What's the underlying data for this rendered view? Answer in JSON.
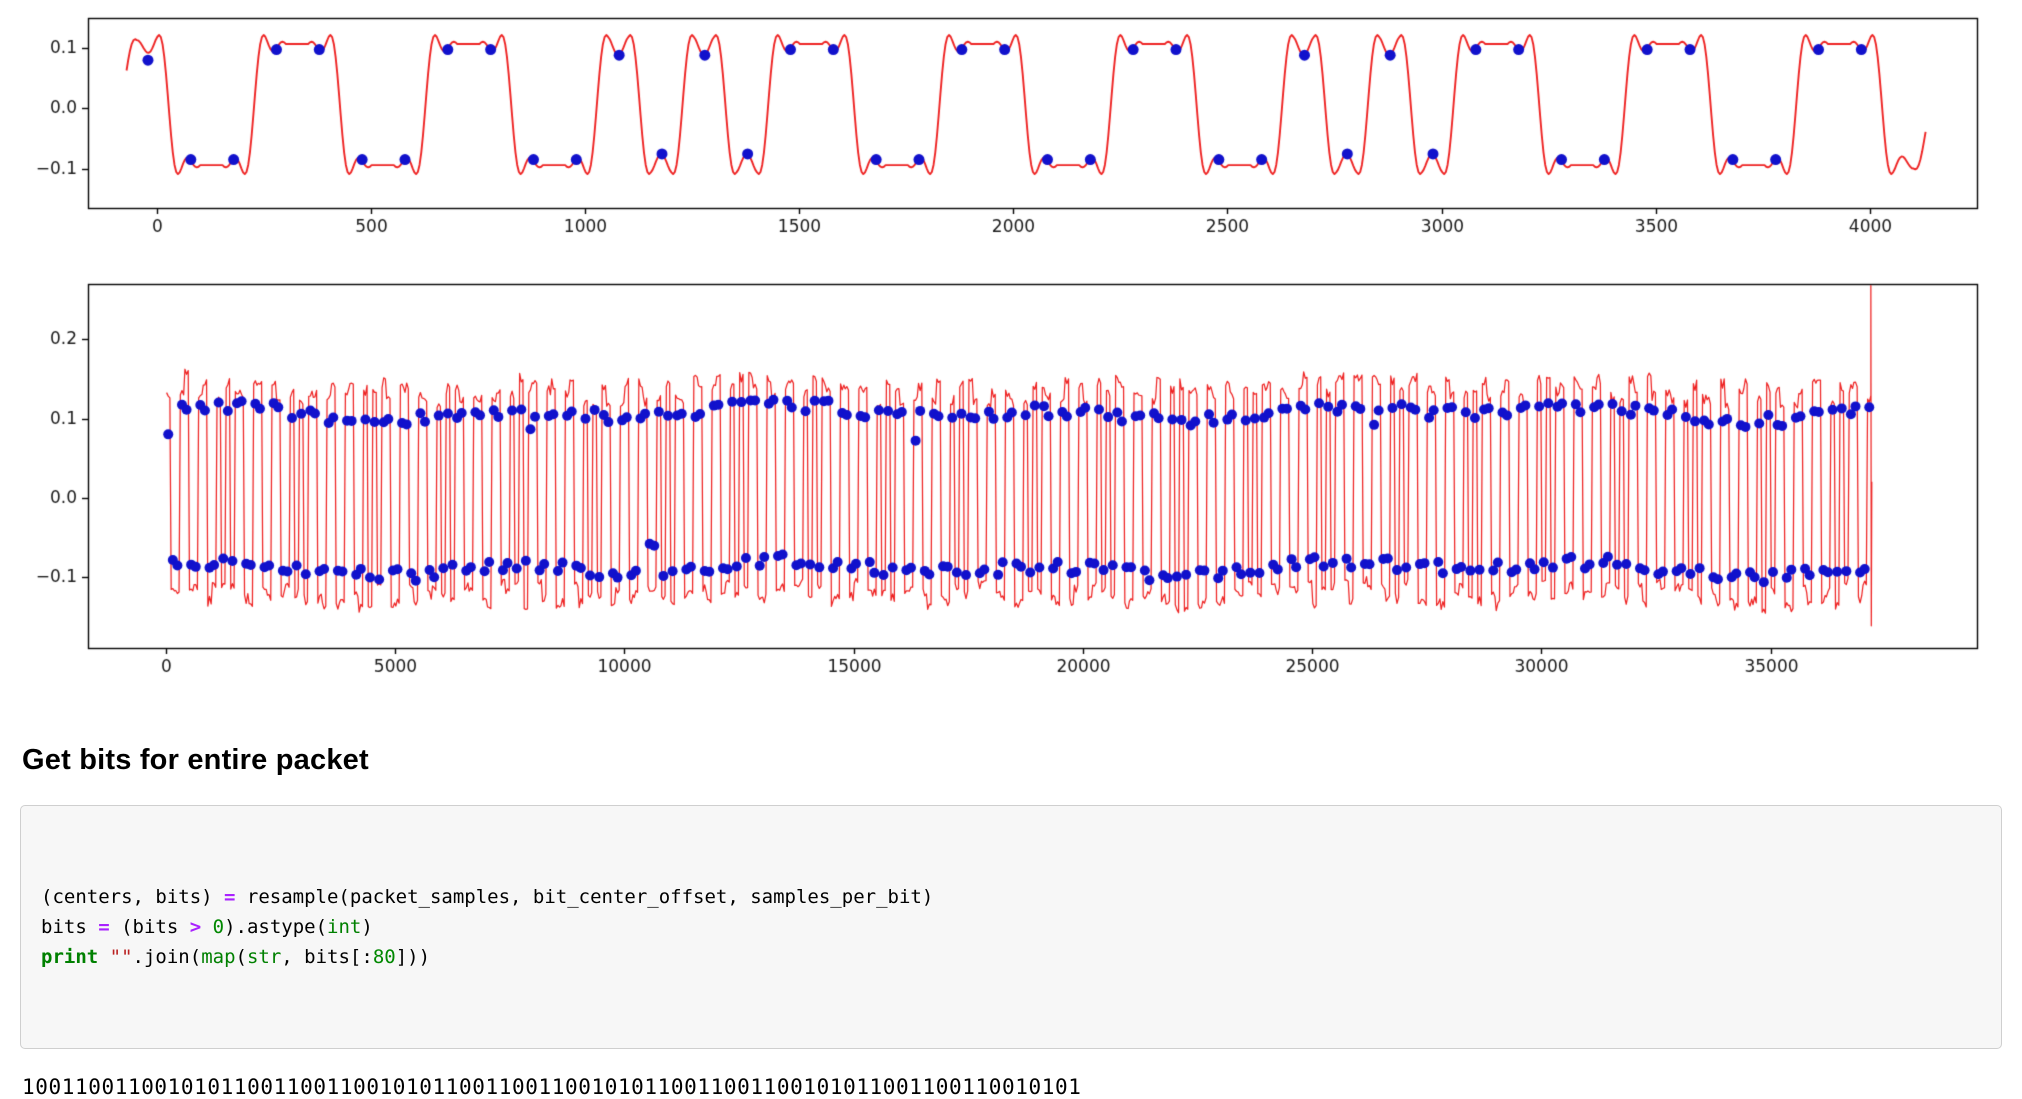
{
  "heading": {
    "text": "Get bits for entire packet"
  },
  "code": {
    "bold_classes": [
      "op",
      "kw"
    ],
    "colors": {
      "pln": "#000000",
      "op": "#AA22FF",
      "kw": "#008000",
      "bi": "#008000",
      "num": "#008800",
      "str": "#BA2121"
    },
    "lines": [
      [
        {
          "t": "(centers, bits) ",
          "c": "pln"
        },
        {
          "t": "=",
          "c": "op"
        },
        {
          "t": " resample(packet_samples, bit_center_offset, samples_per_bit)",
          "c": "pln"
        }
      ],
      [
        {
          "t": "bits ",
          "c": "pln"
        },
        {
          "t": "=",
          "c": "op"
        },
        {
          "t": " (bits ",
          "c": "pln"
        },
        {
          "t": ">",
          "c": "op"
        },
        {
          "t": " ",
          "c": "pln"
        },
        {
          "t": "0",
          "c": "num"
        },
        {
          "t": ").astype(",
          "c": "pln"
        },
        {
          "t": "int",
          "c": "bi"
        },
        {
          "t": ")",
          "c": "pln"
        }
      ],
      [
        {
          "t": "print",
          "c": "kw"
        },
        {
          "t": " ",
          "c": "pln"
        },
        {
          "t": "\"\"",
          "c": "str"
        },
        {
          "t": ".join(",
          "c": "pln"
        },
        {
          "t": "map",
          "c": "bi"
        },
        {
          "t": "(",
          "c": "pln"
        },
        {
          "t": "str",
          "c": "bi"
        },
        {
          "t": ", bits[:",
          "c": "pln"
        },
        {
          "t": "80",
          "c": "num"
        },
        {
          "t": "]))",
          "c": "pln"
        }
      ]
    ]
  },
  "output": {
    "bits": "10011001100101011001100110010101100110011001010110011001100101011001100110010101"
  },
  "chart_data": [
    {
      "type": "line",
      "title": "",
      "description": "Start of packet: filtered bit waveform (red line) with resampled bit-center samples (blue dots)",
      "xlim": [
        -160,
        4250
      ],
      "ylim": [
        -0.165,
        0.15
      ],
      "xticks": [
        0,
        500,
        1000,
        1500,
        2000,
        2500,
        3000,
        3500,
        4000
      ],
      "yticks": [
        -0.1,
        0.0,
        0.1
      ],
      "grid": false,
      "legend": null,
      "series": [
        {
          "name": "packet_samples",
          "kind": "line",
          "color": "#ee2222"
        },
        {
          "name": "bit_centers",
          "kind": "scatter",
          "color": "#1111cc"
        }
      ],
      "signal": {
        "bits_from": "output.bits",
        "num_bits": 42,
        "num_dots": 41,
        "samples_per_bit": 100,
        "x_start": -70,
        "high_level": 0.107,
        "low_level": -0.094,
        "ripple_wavelength": 44,
        "first_dot_y": 0.08
      }
    },
    {
      "type": "line",
      "title": "",
      "description": "Entire packet: bit waveform (red) with resampled bit-center samples (blue dots) and end-of-packet spike",
      "xlim": [
        -1700,
        39500
      ],
      "ylim": [
        -0.19,
        0.27
      ],
      "xticks": [
        0,
        5000,
        10000,
        15000,
        20000,
        25000,
        30000,
        35000
      ],
      "yticks": [
        -0.1,
        0.0,
        0.1,
        0.2
      ],
      "grid": false,
      "legend": null,
      "series": [
        {
          "name": "packet_samples",
          "kind": "line",
          "color": "#ee2222"
        },
        {
          "name": "bit_centers",
          "kind": "scatter",
          "color": "#1111cc"
        }
      ],
      "signal": {
        "bits_from": "output.bits",
        "num_bits": 372,
        "samples_per_bit": 100,
        "high_band": 0.107,
        "low_band": -0.089,
        "red_top_range": [
          0.118,
          0.152
        ],
        "red_bottom_range": [
          -0.138,
          -0.106
        ],
        "dot_noise": 0.008,
        "seed": 123456789,
        "first_dot_y": 0.08,
        "end_spike": {
          "top": 0.268,
          "bottom": -0.162
        }
      }
    }
  ]
}
